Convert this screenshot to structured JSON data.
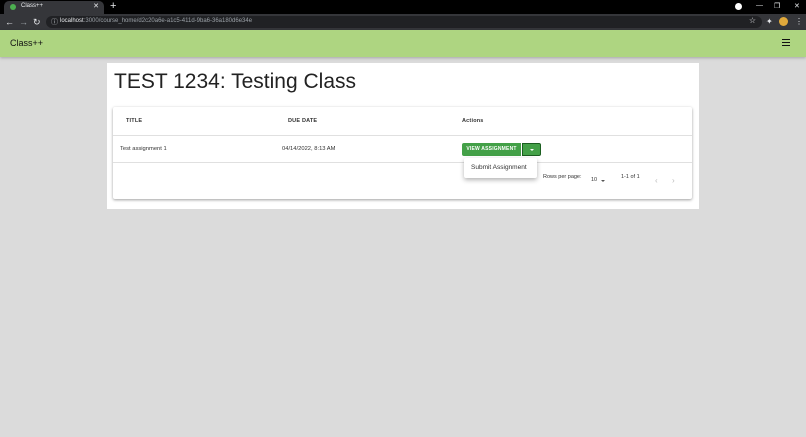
{
  "browser": {
    "tab_title": "Class++",
    "tab_close": "✕",
    "new_tab": "+",
    "url_host": "localhost",
    "url_rest": ":3000/course_home/d2c20a6e-a1c5-411d-9ba6-36a180d6e34e",
    "win_min": "—",
    "win_restore": "❐",
    "win_close": "✕"
  },
  "appbar": {
    "brand": "Class++",
    "menu_icon": "hamburger-menu-icon"
  },
  "course": {
    "title": "TEST 1234: Testing Class"
  },
  "table": {
    "headers": [
      "TITLE",
      "DUE DATE",
      "Actions"
    ],
    "rows": [
      {
        "title": "Test assignment 1",
        "due": "04/14/2022, 8:13 AM"
      }
    ],
    "view_button": "VIEW ASSIGNMENT",
    "dropdown_item": "Submit Assignment",
    "rows_per_page_label": "Rows per page:",
    "rows_per_page_value": "10",
    "range": "1-1 of 1"
  },
  "colors": {
    "appbar": "#aed581",
    "button": "#43a047",
    "background": "#dbdbdb"
  }
}
